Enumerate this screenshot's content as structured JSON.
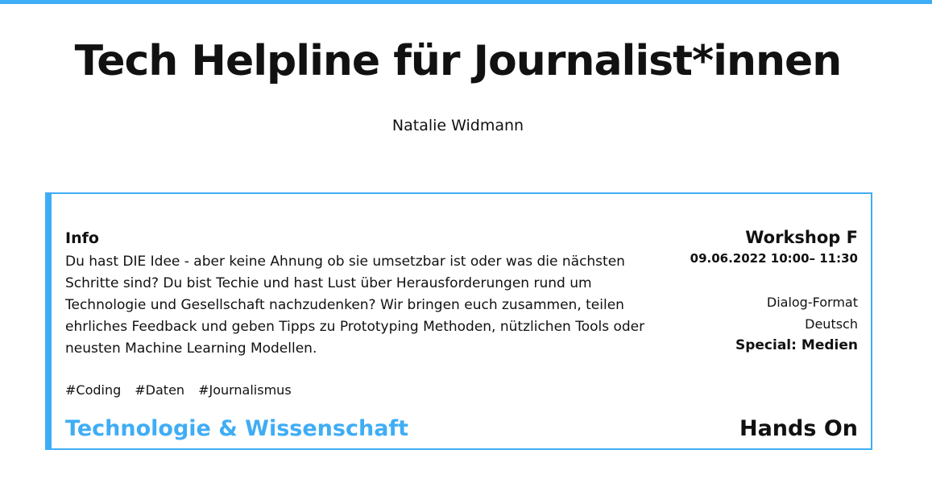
{
  "colors": {
    "accent": "#3fadf5",
    "text": "#111111",
    "background": "#ffffff"
  },
  "page": {
    "title": "Tech Helpline für Journalist*innen",
    "speaker": "Natalie Widmann"
  },
  "card": {
    "info_heading": "Info",
    "description": "Du hast DIE Idee - aber keine Ahnung ob sie umsetzbar ist oder was die nächsten Schritte sind? Du bist Techie und hast Lust über Herausforderungen rund um Technologie und Gesellschaft nachzudenken? Wir bringen euch zusammen, teilen ehrliches Feedback und geben Tipps zu Prototyping Methoden, nützlichen Tools oder neusten Machine Learning Modellen.",
    "tags": [
      "#Coding",
      "#Daten",
      "#Journalismus"
    ],
    "category": "Technologie & Wissenschaft",
    "session_label": "Workshop F",
    "datetime": "09.06.2022 10:00– 11:30",
    "format": "Dialog-Format",
    "language": "Deutsch",
    "special_label": "Special:",
    "special_value": "Medien",
    "type": "Hands On"
  }
}
